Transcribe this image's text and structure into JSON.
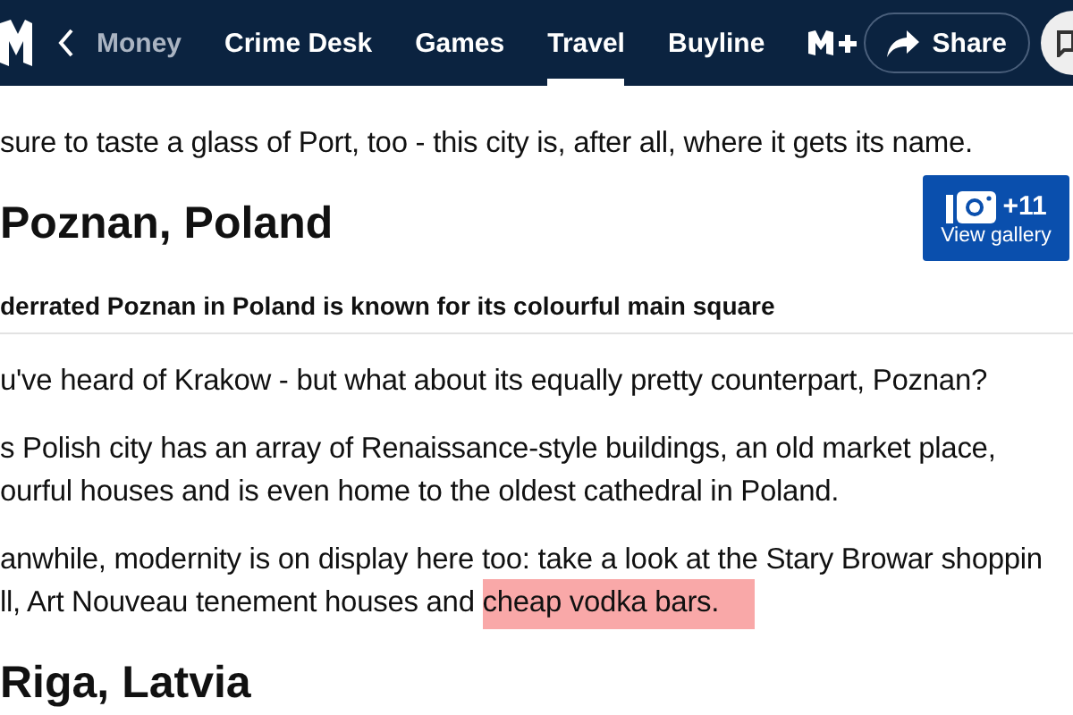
{
  "nav": {
    "items": [
      {
        "label": "Money",
        "selected": false,
        "faded": true
      },
      {
        "label": "Crime Desk",
        "selected": false,
        "faded": false
      },
      {
        "label": "Games",
        "selected": false,
        "faded": false
      },
      {
        "label": "Travel",
        "selected": true,
        "faded": false
      },
      {
        "label": "Buyline",
        "selected": false,
        "faded": false
      }
    ],
    "share": "Share"
  },
  "article": [
    {
      "kind": "para",
      "lines": [
        {
          "text": "sure to taste a glass of Port, too - this city is, after all, where it gets its name."
        }
      ]
    },
    {
      "kind": "heading",
      "text": "Poznan, Poland",
      "gallery": {
        "count": "+11",
        "label": "View gallery"
      }
    },
    {
      "kind": "caption",
      "text": "derrated Poznan in Poland is known for its colourful main square"
    },
    {
      "kind": "para",
      "lines": [
        {
          "text": "u've heard of Krakow - but what about its equally pretty counterpart, Poznan?"
        }
      ]
    },
    {
      "kind": "para",
      "lines": [
        {
          "text": "s Polish city has an array of Renaissance-style buildings, an old market place,"
        },
        {
          "text": "ourful houses and is even home to the oldest cathedral in Poland."
        }
      ]
    },
    {
      "kind": "para",
      "lines": [
        {
          "text": "anwhile, modernity is on display here too: take a look at the Stary Browar shoppin"
        },
        {
          "text": "ll, Art Nouveau tenement houses and ",
          "highlight": "cheap vodka bars."
        }
      ]
    },
    {
      "kind": "heading",
      "text": "Riga, Latvia"
    }
  ]
}
